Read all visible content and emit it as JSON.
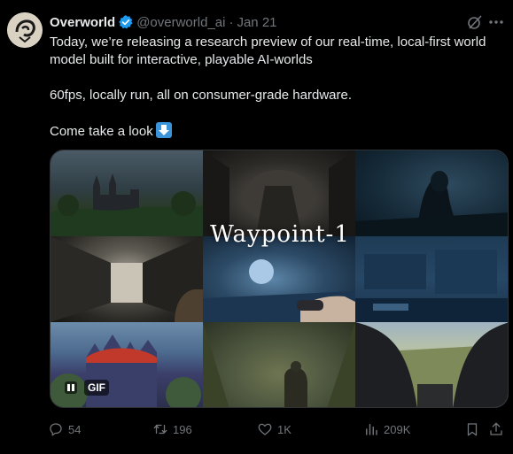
{
  "author": {
    "display_name": "Overworld",
    "handle": "@overworld_ai",
    "separator": "·",
    "date": "Jan 21"
  },
  "tweet": {
    "line1": "Today, we’re releasing a research preview of our real-time, local-first world",
    "line2": "model built for interactive, playable AI-worlds",
    "line3": "60fps, locally run, all on consumer-grade hardware.",
    "line4": "Come take a look"
  },
  "media": {
    "overlay_title": "Waypoint-1",
    "badge": "GIF",
    "tiles": [
      "gothic-castle",
      "dark-corridor",
      "hooded-figure",
      "lit-hallway",
      "flooded-room-flashlight",
      "blue-machinery",
      "red-castle-fantasy",
      "jungle-soldier",
      "helicopter-cockpit"
    ]
  },
  "actions": {
    "replies": "54",
    "retweets": "196",
    "likes": "1K",
    "views": "209K"
  },
  "colors": {
    "background": "#000000",
    "text": "#e7e9ea",
    "muted": "#71767b",
    "verified": "#1d9bf0",
    "border": "#2f3336"
  },
  "icons": [
    "verified-badge-icon",
    "grok-icon",
    "more-icon",
    "arrow-down-emoji",
    "pause-icon",
    "reply-icon",
    "retweet-icon",
    "like-icon",
    "views-icon",
    "bookmark-icon",
    "share-icon"
  ]
}
